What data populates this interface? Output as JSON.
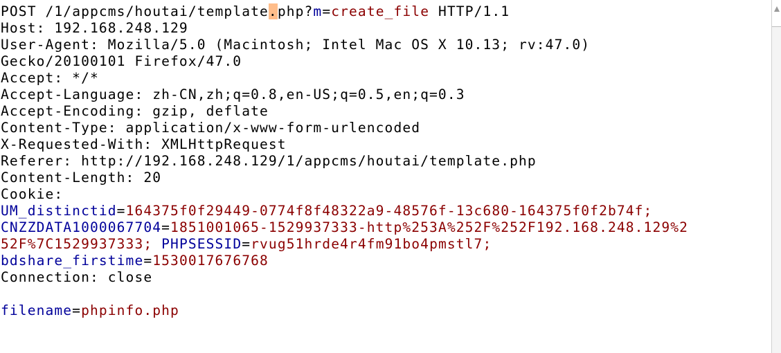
{
  "request_line": {
    "method": "POST",
    "path_before_cursor": "/1/appcms/houtai/template",
    "cursor_char": ".",
    "path_after_cursor": "php?",
    "param_key": "m",
    "param_value": "create_file",
    "protocol": "HTTP/1.1"
  },
  "headers": [
    "Host: 192.168.248.129",
    "User-Agent: Mozilla/5.0 (Macintosh; Intel Mac OS X 10.13; rv:47.0)",
    "Gecko/20100101 Firefox/47.0",
    "Accept: */*",
    "Accept-Language: zh-CN,zh;q=0.8,en-US;q=0.5,en;q=0.3",
    "Accept-Encoding: gzip, deflate",
    "Content-Type: application/x-www-form-urlencoded",
    "X-Requested-With: XMLHttpRequest",
    "Referer: http://192.168.248.129/1/appcms/houtai/template.php",
    "Content-Length: 20",
    "Cookie:"
  ],
  "cookies": {
    "um_key": "UM_distinctid",
    "um_value": "164375f0f29449-0774f8f48322a9-48576f-13c680-164375f0f2b74f;",
    "cnzz_key": "CNZZDATA1000067704",
    "cnzz_value_line1": "1851001065-1529937333-http%253A%252F%252F192.168.248.129%2",
    "cnzz_value_line2": "52F%7C1529937333;",
    "phpsessid_key": "PHPSESSID",
    "phpsessid_value": "rvug51hrde4r4fm91bo4pmstl7;",
    "bdshare_key": "bdshare_firstime",
    "bdshare_value": "1530017676768"
  },
  "connection": "Connection: close",
  "body": {
    "key": "filename",
    "value": "phpinfo.php"
  },
  "colors": {
    "param_key": "#00009a",
    "param_value": "#8b0000",
    "cursor_highlight": "#ffbd8a"
  }
}
